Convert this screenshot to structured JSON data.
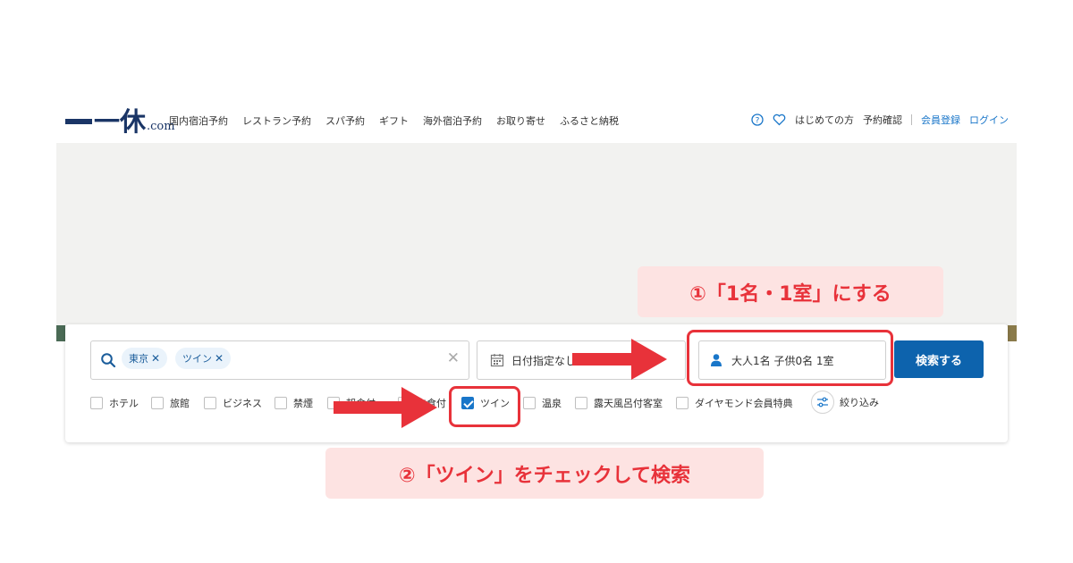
{
  "header": {
    "logo": {
      "kanji": "一休",
      "suffix": ".com"
    },
    "nav": [
      "国内宿泊予約",
      "レストラン予約",
      "スパ予約",
      "ギフト",
      "海外宿泊予約",
      "お取り寄せ",
      "ふるさと納税"
    ],
    "right": {
      "help_icon": "help-circle-icon",
      "favorite_icon": "heart-icon",
      "first_time": "はじめての方",
      "reservation_check": "予約確認",
      "register": "会員登録",
      "login": "ログイン"
    }
  },
  "search": {
    "chips": [
      {
        "label": "東京",
        "remove": "✕"
      },
      {
        "label": "ツイン",
        "remove": "✕"
      }
    ],
    "clear": "✕",
    "date_text": "日付指定なし",
    "guests_text": "大人1名 子供0名 1室",
    "button": "検索する"
  },
  "filters": [
    {
      "label": "ホテル",
      "checked": false
    },
    {
      "label": "旅館",
      "checked": false
    },
    {
      "label": "ビジネス",
      "checked": false
    },
    {
      "label": "禁煙",
      "checked": false
    },
    {
      "label": "朝食付",
      "checked": false
    },
    {
      "label": "夕食付",
      "checked": false
    },
    {
      "label": "ツイン",
      "checked": true
    },
    {
      "label": "温泉",
      "checked": false
    },
    {
      "label": "露天風呂付客室",
      "checked": false
    },
    {
      "label": "ダイヤモンド会員特典",
      "checked": false
    }
  ],
  "refine_label": "絞り込み",
  "annotations": {
    "step1": "①「1名・1室」にする",
    "step2": "②「ツイン」をチェックして検索",
    "accent_color": "#e8323a"
  },
  "colors": {
    "brand": "#1a3566",
    "primary": "#0d63ad",
    "link": "#1976c9"
  }
}
